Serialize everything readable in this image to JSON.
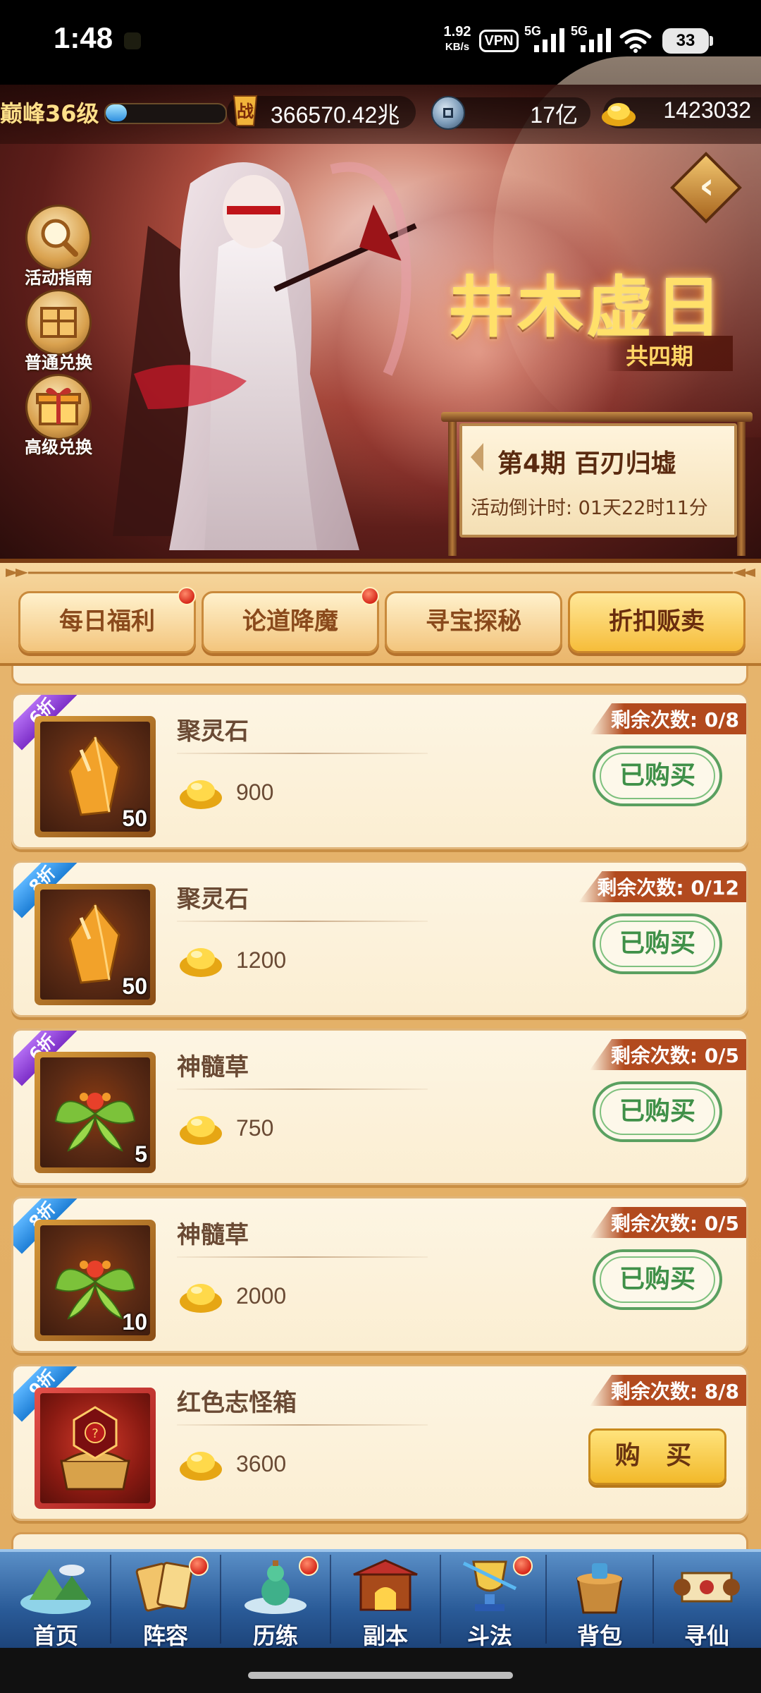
{
  "status_bar": {
    "time": "1:48",
    "net_speed_value": "1.92",
    "net_speed_unit": "KB/s",
    "vpn": "VPN",
    "network_1": "5G",
    "network_2": "5G",
    "battery": "33"
  },
  "header": {
    "level": "巅峰36级",
    "level_progress_pct": 18,
    "power": "366570.42兆",
    "silver": "17亿",
    "gold": "1423032"
  },
  "banner": {
    "side_buttons": [
      "活动指南",
      "普通兑换",
      "高级兑换"
    ],
    "title": "井木虚日",
    "subtitle": "共四期",
    "period_title": "第4期  百刃归墟",
    "countdown": "活动倒计时: 01天22时11分"
  },
  "tabs": [
    {
      "label": "每日福利",
      "has_dot": true,
      "active": false
    },
    {
      "label": "论道降魔",
      "has_dot": true,
      "active": false
    },
    {
      "label": "寻宝探秘",
      "has_dot": false,
      "active": false
    },
    {
      "label": "折扣贩卖",
      "has_dot": false,
      "active": true
    }
  ],
  "items": [
    {
      "discount": "6折",
      "name": "聚灵石",
      "qty": "50",
      "price": "900",
      "remaining": "剩余次数: 0/8",
      "action": "已购买",
      "icon": "crystal-icon"
    },
    {
      "discount": "8折",
      "name": "聚灵石",
      "qty": "50",
      "price": "1200",
      "remaining": "剩余次数: 0/12",
      "action": "已购买",
      "icon": "crystal-icon"
    },
    {
      "discount": "6折",
      "name": "神髓草",
      "qty": "5",
      "price": "750",
      "remaining": "剩余次数: 0/5",
      "action": "已购买",
      "icon": "herb-icon"
    },
    {
      "discount": "8折",
      "name": "神髓草",
      "qty": "10",
      "price": "2000",
      "remaining": "剩余次数: 0/5",
      "action": "已购买",
      "icon": "herb-icon"
    },
    {
      "discount": "9折",
      "name": "红色志怪箱",
      "qty": "",
      "price": "3600",
      "remaining": "剩余次数: 8/8",
      "action": "购 买",
      "icon": "red-chest-icon"
    }
  ],
  "nav": [
    {
      "label": "首页",
      "has_dot": false
    },
    {
      "label": "阵容",
      "has_dot": true
    },
    {
      "label": "历练",
      "has_dot": true
    },
    {
      "label": "副本",
      "has_dot": false
    },
    {
      "label": "斗法",
      "has_dot": true
    },
    {
      "label": "背包",
      "has_dot": false
    },
    {
      "label": "寻仙",
      "has_dot": false
    }
  ],
  "colors": {
    "accent_gold": "#ffe06a",
    "bought_green": "#3f9048",
    "ribbon_purple": "#7d2fc8",
    "ribbon_blue": "#1e7fd6",
    "remain_red": "#b24a1e",
    "nav_blue": "#2a5b98"
  }
}
